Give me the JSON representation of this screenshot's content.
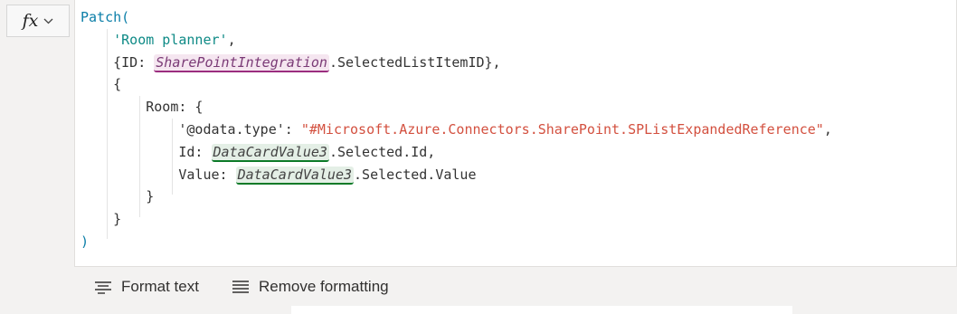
{
  "formula_bar": {
    "fx_label": "fx",
    "lines": [
      [
        {
          "t": "Patch(",
          "c": "kw"
        }
      ],
      [
        {
          "t": "    "
        },
        {
          "t": "'Room planner'",
          "c": "str"
        },
        {
          "t": ","
        }
      ],
      [
        {
          "t": "    {ID: "
        },
        {
          "t": "SharePointIntegration",
          "c": "tok-pink"
        },
        {
          "t": ".SelectedListItemID},"
        }
      ],
      [
        {
          "t": "    {"
        }
      ],
      [
        {
          "t": "        Room: {"
        }
      ],
      [
        {
          "t": "            '@odata.type': "
        },
        {
          "t": "\"#Microsoft.Azure.Connectors.SharePoint.SPListExpandedReference\"",
          "c": "url"
        },
        {
          "t": ","
        }
      ],
      [
        {
          "t": "            Id: "
        },
        {
          "t": "DataCardValue3",
          "c": "tok-green"
        },
        {
          "t": ".Selected.Id,"
        }
      ],
      [
        {
          "t": "            Value: "
        },
        {
          "t": "DataCardValue3",
          "c": "tok-green"
        },
        {
          "t": ".Selected.Value"
        }
      ],
      [
        {
          "t": "        }"
        }
      ],
      [
        {
          "t": "    }"
        }
      ],
      [
        {
          "t": ")",
          "c": "kw"
        }
      ]
    ]
  },
  "toolbar": {
    "format_text_label": "Format text",
    "remove_formatting_label": "Remove formatting"
  },
  "colors": {
    "function": "#0b7ea8",
    "string": "#0e8a86",
    "url_string": "#d3503f",
    "control_token": "#9b2d7f",
    "datacard_token": "#0c7a28"
  }
}
